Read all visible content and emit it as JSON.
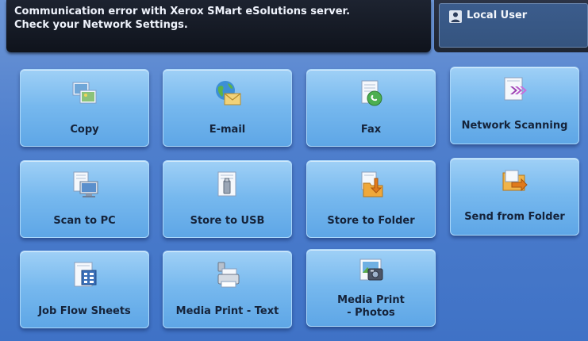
{
  "status": {
    "message": "Communication error with Xerox SMart eSolutions server.\nCheck your Network Settings."
  },
  "user": {
    "label": "Local User",
    "icon": "user-icon"
  },
  "tiles": [
    {
      "label": "Copy",
      "icon": "copy-icon"
    },
    {
      "label": "E-mail",
      "icon": "email-icon"
    },
    {
      "label": "Fax",
      "icon": "fax-icon"
    },
    {
      "label": "Network Scanning",
      "icon": "network-scanning-icon"
    },
    {
      "label": "Scan to PC",
      "icon": "scan-to-pc-icon"
    },
    {
      "label": "Store to USB",
      "icon": "store-to-usb-icon"
    },
    {
      "label": "Store to Folder",
      "icon": "store-to-folder-icon"
    },
    {
      "label": "Send from Folder",
      "icon": "send-from-folder-icon"
    },
    {
      "label": "Job Flow Sheets",
      "icon": "job-flow-sheets-icon"
    },
    {
      "label": "Media Print - Text",
      "icon": "media-print-text-icon"
    },
    {
      "label": "Media Print\n- Photos",
      "icon": "media-print-photos-icon"
    }
  ],
  "colors": {
    "tile_top": "#9fd0f6",
    "tile_bottom": "#5ea6e6",
    "background": "#4f7fcd",
    "message_bar": "#0f131c",
    "label_text": "#15233a"
  }
}
